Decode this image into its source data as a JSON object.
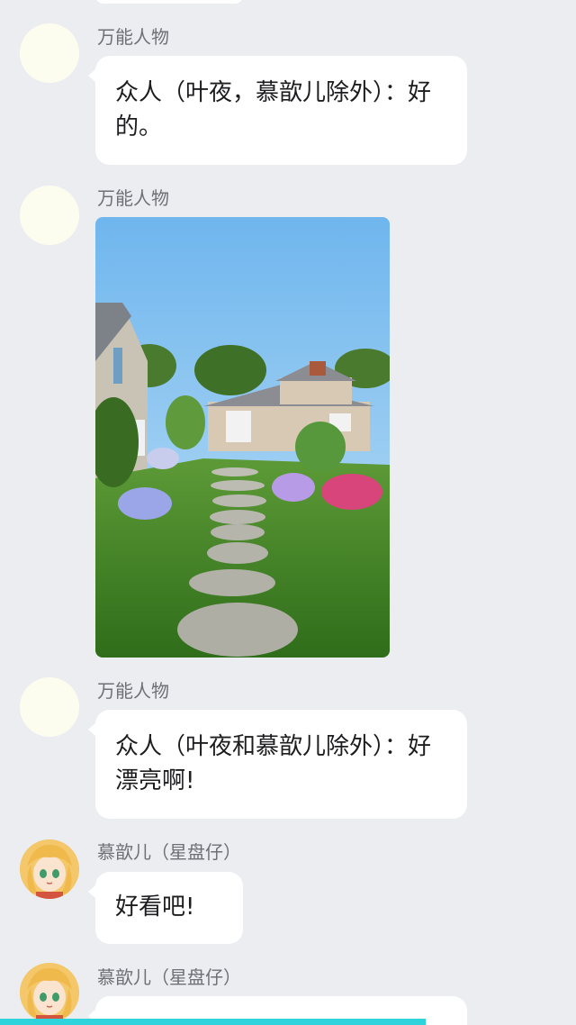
{
  "messages": [
    {
      "sender": "万能人物",
      "type": "text",
      "text": "众人（叶夜，慕歆儿除外）：好的。"
    },
    {
      "sender": "万能人物",
      "type": "image",
      "image_icon": "garden-photo-icon"
    },
    {
      "sender": "万能人物",
      "type": "text",
      "text": "众人（叶夜和慕歆儿除外）：好漂亮啊!"
    },
    {
      "sender": "慕歆儿（星盘仔）",
      "type": "text",
      "text": "好看吧!"
    },
    {
      "sender": "慕歆儿（星盘仔）",
      "type": "text",
      "text": ""
    }
  ],
  "colors": {
    "background": "#ebedf1",
    "bubble": "#ffffff",
    "sender_text": "#6f7075",
    "message_text": "#1d1d1f",
    "bottom_bar": "#2fd3dc",
    "plain_avatar": "#fdfdef"
  }
}
